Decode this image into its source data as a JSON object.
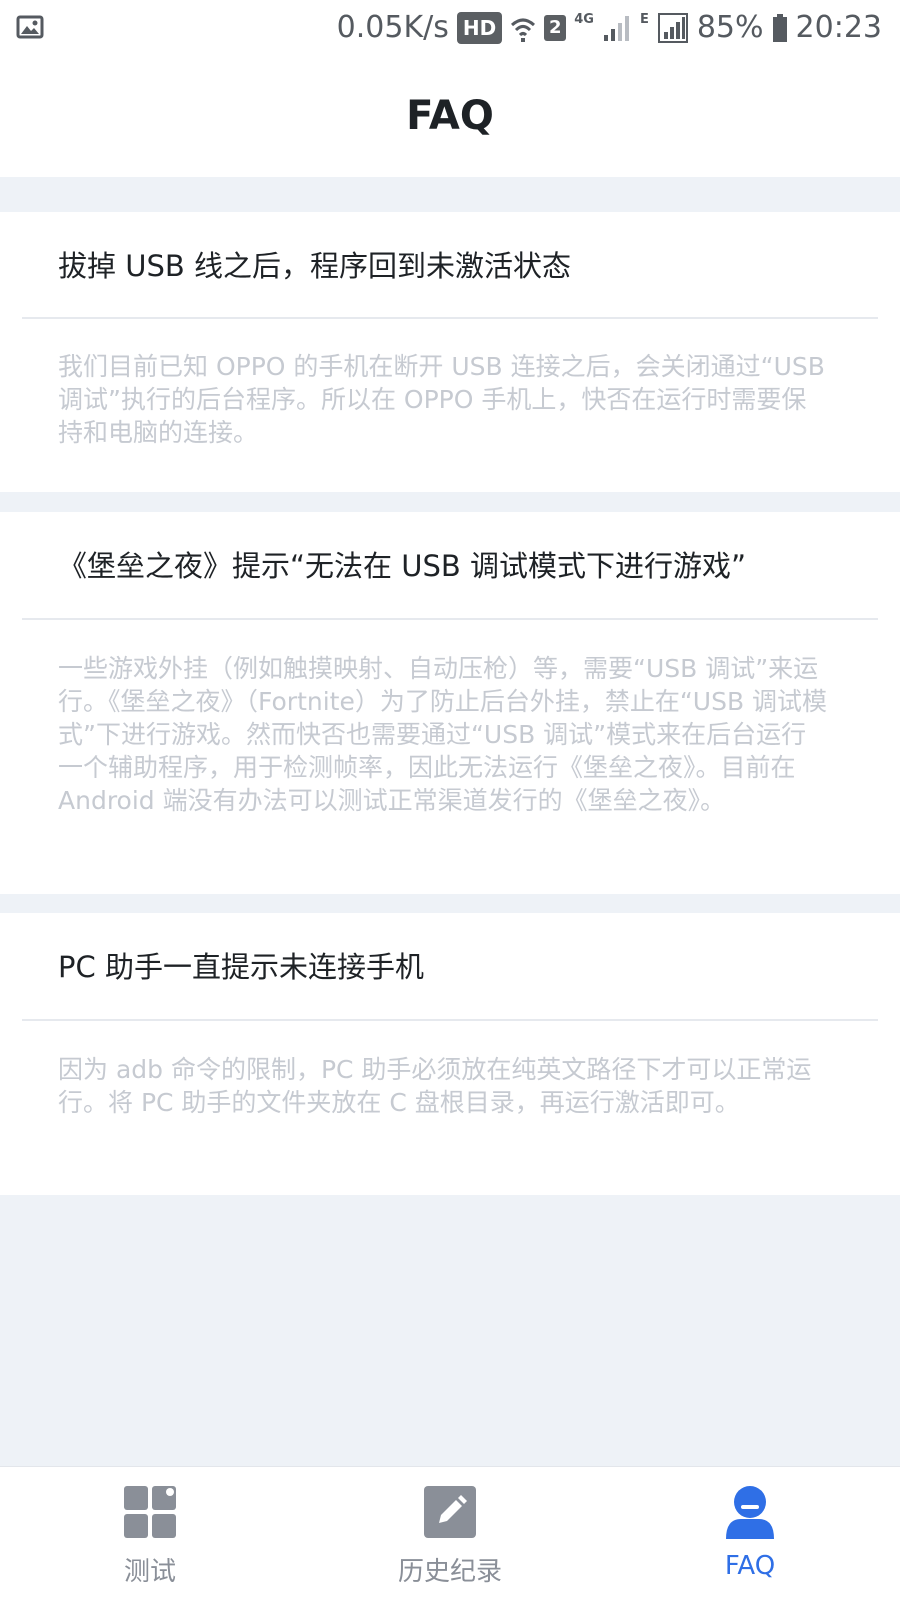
{
  "status_bar": {
    "speed": "0.05K/s",
    "hd": "HD",
    "sim": "2",
    "net_4g": "4G",
    "net_e": "E",
    "battery": "85%",
    "time": "20:23",
    "icons": [
      "image-icon",
      "wifi-icon",
      "signal-icon",
      "battery-icon"
    ]
  },
  "header": {
    "title": "FAQ"
  },
  "faq": [
    {
      "question": "拔掉 USB 线之后，程序回到未激活状态",
      "answer": "我们目前已知 OPPO 的手机在断开 USB 连接之后，会关闭通过“USB 调试”执行的后台程序。所以在 OPPO 手机上，快否在运行时需要保持和电脑的连接。"
    },
    {
      "question": "《堡垒之夜》提示“无法在 USB 调试模式下进行游戏”",
      "answer": "一些游戏外挂（例如触摸映射、自动压枪）等，需要“USB 调试”来运行。《堡垒之夜》（Fortnite）为了防止后台外挂，禁止在“USB 调试模式”下进行游戏。然而快否也需要通过“USB 调试”模式来在后台运行一个辅助程序，用于检测帧率，因此无法运行《堡垒之夜》。目前在 Android 端没有办法可以测试正常渠道发行的《堡垒之夜》。"
    },
    {
      "question": "PC 助手一直提示未连接手机",
      "answer": "因为 adb 命令的限制，PC 助手必须放在纯英文路径下才可以正常运行。将 PC 助手的文件夹放在 C 盘根目录，再运行激活即可。"
    }
  ],
  "tabs": [
    {
      "label": "测试",
      "icon": "grid-icon",
      "active": false
    },
    {
      "label": "历史纪录",
      "icon": "edit-icon",
      "active": false
    },
    {
      "label": "FAQ",
      "icon": "person-icon",
      "active": true
    }
  ],
  "colors": {
    "accent": "#2f6fe6",
    "inactive_icon": "#8a8f98",
    "answer_text": "#c6cad1",
    "page_bg": "#eef2f7"
  }
}
